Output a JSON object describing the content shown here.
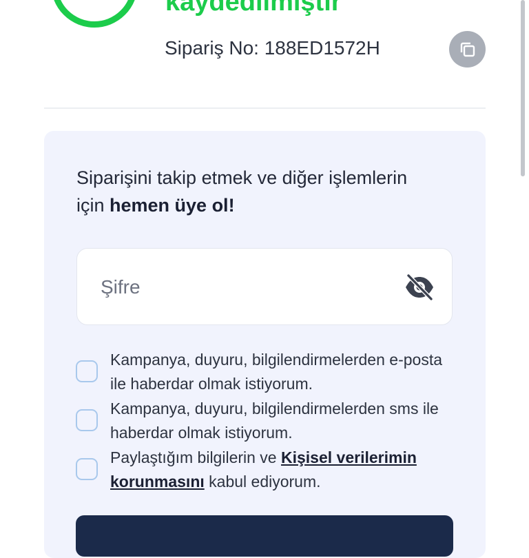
{
  "order": {
    "title": "kaydedilmiştir",
    "order_number": "Sipariş No: 188ED1572H",
    "status_color": "#1ccc4b"
  },
  "icons": {
    "success": "check-circle-icon",
    "copy": "copy-icon",
    "password_toggle": "eye-off-icon"
  },
  "signup": {
    "prompt_text": "Siparişini takip etmek ve diğer işlemlerin için ",
    "prompt_bold": "hemen üye ol!",
    "password_placeholder": "Şifre"
  },
  "consents": [
    {
      "text": "Kampanya, duyuru, bilgilendirmelerden e-posta ile haberdar olmak istiyorum.",
      "checked": false
    },
    {
      "text": "Kampanya, duyuru, bilgilendirmelerden sms ile haberdar olmak istiyorum.",
      "checked": false
    },
    {
      "text_before": "Paylaştığım bilgilerin ve ",
      "link": "Kişisel verilerimin korunmasını",
      "text_after": " kabul ediyorum.",
      "checked": false
    }
  ]
}
